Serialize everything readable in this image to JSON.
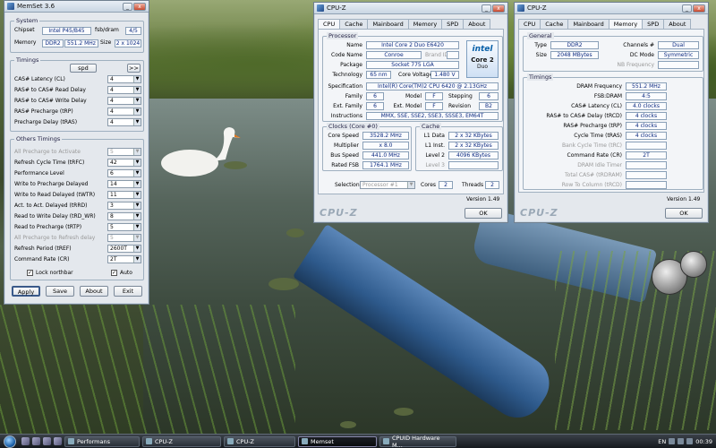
{
  "memset": {
    "title": "MemSet 3.6",
    "system_group": "System",
    "chipset_label": "Chipset",
    "chipset_value": "Intel P45/B45",
    "fsb_dram_label": "fsb/dram",
    "fsb_dram_value": "4/5",
    "memory_label": "Memory",
    "memory_type": "DDR2",
    "memory_freq": "551.2 MHz",
    "size_label": "Size",
    "size_value": "2 x 1024",
    "timings_group": "Timings",
    "spd_button": "spd",
    "nav_button": ">>",
    "timings": [
      {
        "label": "CAS# Latency (CL)",
        "value": "4"
      },
      {
        "label": "RAS# to CAS# Read Delay",
        "value": "4"
      },
      {
        "label": "RAS# to CAS# Write Delay",
        "value": "4"
      },
      {
        "label": "RAS# Precharge (tRP)",
        "value": "4"
      },
      {
        "label": "Precharge Delay (tRAS)",
        "value": "4"
      }
    ],
    "others_group": "Others Timings",
    "others": [
      {
        "label": "All Precharge to Activate",
        "value": "5",
        "dim": true
      },
      {
        "label": "Refresh Cycle Time (tRFC)",
        "value": "42"
      },
      {
        "label": "Performance Level",
        "value": "6"
      },
      {
        "label": "Write to Precharge Delayed",
        "value": "14"
      },
      {
        "label": "Write to Read Delayed (tWTR)",
        "value": "11"
      },
      {
        "label": "Act. to Act. Delayed (tRRD)",
        "value": "3"
      },
      {
        "label": "Read to Write Delay (tRD_WR)",
        "value": "8"
      },
      {
        "label": "Read to Precharge (tRTP)",
        "value": "5"
      },
      {
        "label": "All Precharge to Refresh delay",
        "value": "5",
        "dim": true
      },
      {
        "label": "Refresh Period (tREF)",
        "value": "2600T"
      },
      {
        "label": "Command Rate (CR)",
        "value": "2T"
      }
    ],
    "lock_label": "Lock northbar",
    "lock_checked": "✓",
    "auto_label": "Auto",
    "auto_checked": "✓",
    "buttons": {
      "apply": "Apply",
      "save": "Save",
      "about": "About",
      "exit": "Exit"
    }
  },
  "cpuz_cpu": {
    "title": "CPU-Z",
    "tabs": [
      "CPU",
      "Cache",
      "Mainboard",
      "Memory",
      "SPD",
      "About"
    ],
    "active_tab": "CPU",
    "processor_group": "Processor",
    "name_label": "Name",
    "name_value": "Intel Core 2 Duo E6420",
    "codename_label": "Code Name",
    "codename_value": "Conroe",
    "brand_label": "Brand ID",
    "package_label": "Package",
    "package_value": "Socket 775 LGA",
    "technology_label": "Technology",
    "technology_value": "65 nm",
    "corevoltage_label": "Core Voltage",
    "corevoltage_value": "1.480 V",
    "spec_label": "Specification",
    "spec_value": "Intel(R) Core(TM)2 CPU          6420  @ 2.13GHz",
    "family_label": "Family",
    "family_value": "6",
    "model_label": "Model",
    "model_value": "F",
    "stepping_label": "Stepping",
    "stepping_value": "6",
    "extfamily_label": "Ext. Family",
    "extfamily_value": "6",
    "extmodel_label": "Ext. Model",
    "extmodel_value": "F",
    "revision_label": "Revision",
    "revision_value": "B2",
    "instructions_label": "Instructions",
    "instructions_value": "MMX, SSE, SSE2, SSE3, SSSE3, EM64T",
    "logo_top": "intel",
    "logo_mid": "Core 2",
    "logo_bot": "Duo",
    "clocks_group": "Clocks (Core #0)",
    "corespeed_label": "Core Speed",
    "corespeed_value": "3528.2 MHz",
    "multiplier_label": "Multiplier",
    "multiplier_value": "x 8.0",
    "busspeed_label": "Bus Speed",
    "busspeed_value": "441.0 MHz",
    "ratedfsb_label": "Rated FSB",
    "ratedfsb_value": "1764.1 MHz",
    "cache_group": "Cache",
    "l1data_label": "L1 Data",
    "l1data_value": "2 x 32 KBytes",
    "l1inst_label": "L1 Inst.",
    "l1inst_value": "2 x 32 KBytes",
    "level2_label": "Level 2",
    "level2_value": "4096 KBytes",
    "level3_label": "Level 3",
    "selection_label": "Selection",
    "selection_value": "Processor #1",
    "cores_label": "Cores",
    "cores_value": "2",
    "threads_label": "Threads",
    "threads_value": "2",
    "version": "Version 1.49",
    "ok": "OK",
    "brand": "CPU-Z"
  },
  "cpuz_mem": {
    "title": "CPU-Z",
    "tabs": [
      "CPU",
      "Cache",
      "Mainboard",
      "Memory",
      "SPD",
      "About"
    ],
    "active_tab": "Memory",
    "general_group": "General",
    "type_label": "Type",
    "type_value": "DDR2",
    "channels_label": "Channels #",
    "channels_value": "Dual",
    "size_label": "Size",
    "size_value": "2048 MBytes",
    "dcmode_label": "DC Mode",
    "dcmode_value": "Symmetric",
    "nbfreq_label": "NB Frequency",
    "timings_group": "Timings",
    "rows": [
      {
        "label": "DRAM Frequency",
        "value": "551.2 MHz"
      },
      {
        "label": "FSB:DRAM",
        "value": "4:5"
      },
      {
        "label": "CAS# Latency (CL)",
        "value": "4.0 clocks"
      },
      {
        "label": "RAS# to CAS# Delay (tRCD)",
        "value": "4 clocks"
      },
      {
        "label": "RAS# Precharge (tRP)",
        "value": "4 clocks"
      },
      {
        "label": "Cycle Time (tRAS)",
        "value": "4 clocks"
      },
      {
        "label": "Bank Cycle Time (tRC)",
        "value": "",
        "dim": true
      },
      {
        "label": "Command Rate (CR)",
        "value": "2T"
      },
      {
        "label": "DRAM Idle Timer",
        "value": "",
        "dim": true
      },
      {
        "label": "Total CAS# (tRDRAM)",
        "value": "",
        "dim": true
      },
      {
        "label": "Row To Column (tRCD)",
        "value": "",
        "dim": true
      }
    ],
    "version": "Version 1.49",
    "ok": "OK",
    "brand": "CPU-Z"
  },
  "taskbar": {
    "tasks": [
      {
        "label": "Performans",
        "active": false
      },
      {
        "label": "CPU-Z",
        "active": false
      },
      {
        "label": "CPU-Z",
        "active": false
      },
      {
        "label": "Memset",
        "active": true
      },
      {
        "label": "CPUID Hardware M...",
        "active": false
      }
    ],
    "language": "EN",
    "clock": "00:39"
  }
}
